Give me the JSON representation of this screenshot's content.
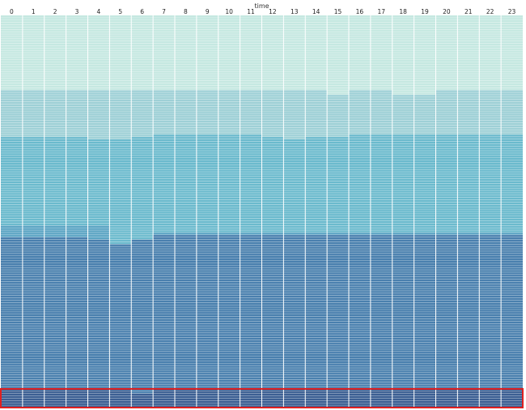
{
  "chart_data": {
    "type": "heatmap",
    "x_axis": {
      "title": "time",
      "position": "top",
      "ticks": [
        "0",
        "1",
        "2",
        "3",
        "4",
        "5",
        "6",
        "7",
        "8",
        "9",
        "10",
        "11",
        "12",
        "13",
        "14",
        "15",
        "16",
        "17",
        "18",
        "19",
        "20",
        "21",
        "22",
        "23"
      ]
    },
    "y_axis": {
      "title": "",
      "tick_labels": []
    },
    "row_count": 168,
    "color_scale": [
      "#c5e8e1",
      "#9ed0d6",
      "#6bbacd",
      "#5aa4c3",
      "#4a80ae",
      "#3c5f93",
      "#2a3a6e"
    ],
    "band_boundaries": {
      "description": "row index where each color level starts, per column",
      "level_1": [
        32,
        32,
        32,
        32,
        32,
        32,
        32,
        32,
        32,
        32,
        32,
        32,
        32,
        32,
        32,
        34,
        32,
        32,
        34,
        34,
        32,
        32,
        32,
        32
      ],
      "level_2": [
        52,
        52,
        52,
        52,
        53,
        53,
        52,
        51,
        51,
        51,
        51,
        51,
        52,
        53,
        52,
        52,
        51,
        51,
        51,
        51,
        51,
        51,
        51,
        51
      ],
      "level_3": [
        90,
        90,
        90,
        90,
        90,
        100,
        98,
        93,
        93,
        93,
        93,
        93,
        93,
        93,
        93,
        93,
        93,
        93,
        93,
        93,
        93,
        93,
        93,
        93
      ],
      "level_4": [
        95,
        95,
        95,
        95,
        96,
        98,
        96,
        94,
        94,
        94,
        94,
        94,
        94,
        94,
        94,
        94,
        94,
        94,
        94,
        94,
        94,
        94,
        94,
        94
      ],
      "level_5": [
        160,
        160,
        160,
        160,
        160,
        160,
        162,
        160,
        160,
        160,
        160,
        160,
        160,
        160,
        160,
        160,
        160,
        160,
        160,
        160,
        160,
        160,
        160,
        160
      ]
    },
    "highlight": {
      "label": "",
      "color": "#e02020",
      "row_range": [
        160,
        167
      ],
      "col_range": [
        0,
        23
      ]
    },
    "grid": true,
    "legend": "none"
  }
}
